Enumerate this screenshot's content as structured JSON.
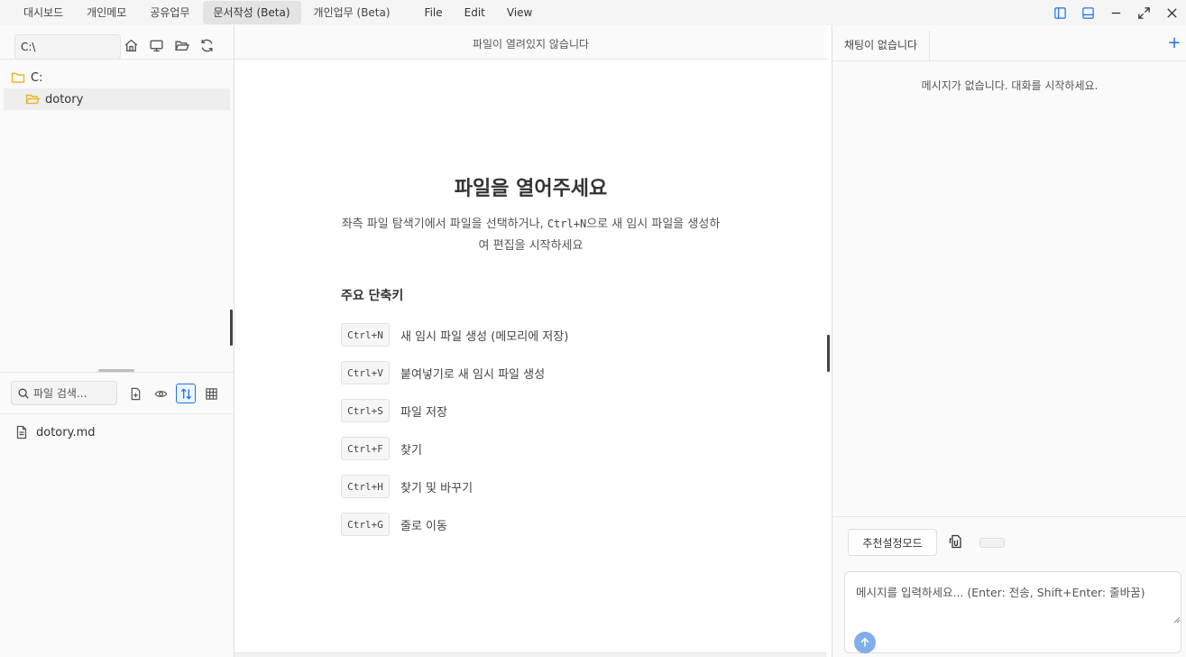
{
  "topbar": {
    "tabs": [
      {
        "label": "대시보드"
      },
      {
        "label": "개인메모"
      },
      {
        "label": "공유업무"
      },
      {
        "label": "문서작성 (Beta)"
      },
      {
        "label": "개인업무 (Beta)"
      }
    ],
    "active_tab": "문서작성 (Beta)",
    "menus": [
      {
        "label": "File"
      },
      {
        "label": "Edit"
      },
      {
        "label": "View"
      }
    ],
    "accent_color": "#1a73e8"
  },
  "explorer": {
    "path": "C:\\",
    "tree": [
      {
        "label": "C:"
      },
      {
        "label": "dotory"
      }
    ],
    "search_placeholder": "파일 검색...",
    "files": [
      {
        "label": "dotory.md"
      }
    ],
    "folder_color": "#f0b429"
  },
  "editor": {
    "header": "파일이 열려있지 않습니다",
    "welcome_title": "파일을 열어주세요",
    "desc_part1": "좌측 파일 탐색기에서 파일을 선택하거나, ",
    "desc_code": "Ctrl+N",
    "desc_part2": "으로 새 임시 파일을 생성하여 편집을 시작하세요",
    "shortcuts_title": "주요 단축키",
    "shortcuts": [
      {
        "key": "Ctrl+N",
        "desc": "새 임시 파일 생성 (메모리에 저장)"
      },
      {
        "key": "Ctrl+V",
        "desc": "붙여넣기로 새 임시 파일 생성"
      },
      {
        "key": "Ctrl+S",
        "desc": "파일 저장"
      },
      {
        "key": "Ctrl+F",
        "desc": "찾기"
      },
      {
        "key": "Ctrl+H",
        "desc": "찾기 및 바꾸기"
      },
      {
        "key": "Ctrl+G",
        "desc": "줄로 이동"
      }
    ]
  },
  "chat": {
    "tab_label": "채팅이 없습니다",
    "plus_label": "+",
    "empty_text": "메시지가 없습니다. 대화를 시작하세요.",
    "recommend_button": "추천설정모드",
    "input_placeholder": "메시지를 입력하세요... (Enter: 전송, Shift+Enter: 줄바꿈)"
  }
}
